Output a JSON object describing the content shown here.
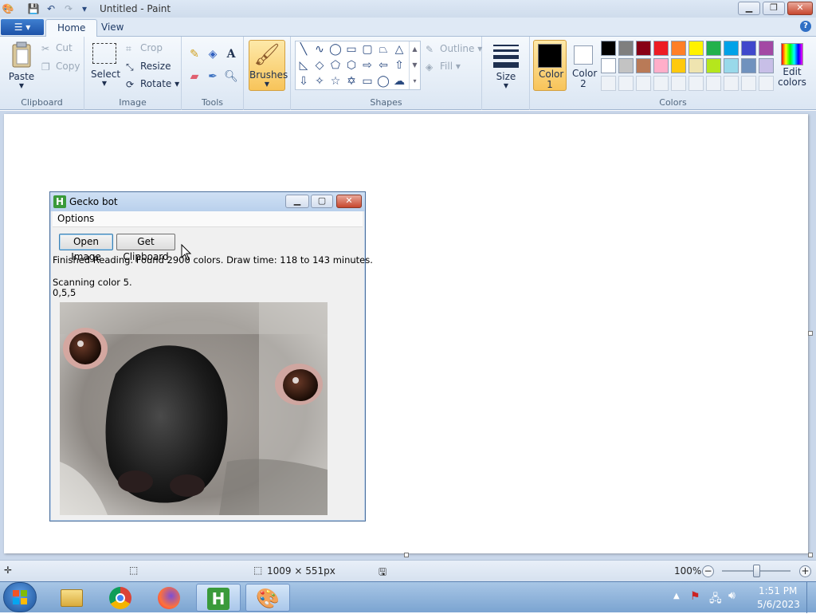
{
  "window": {
    "title": "Untitled - Paint"
  },
  "tabs": [
    {
      "label": "Home"
    },
    {
      "label": "View"
    }
  ],
  "clipboard": {
    "paste": "Paste",
    "cut": "Cut",
    "copy": "Copy",
    "label": "Clipboard"
  },
  "image": {
    "select": "Select",
    "crop": "Crop",
    "resize": "Resize",
    "rotate": "Rotate",
    "label": "Image"
  },
  "tools": {
    "label": "Tools"
  },
  "brushes": {
    "label": "Brushes"
  },
  "shapes": {
    "outline": "Outline",
    "fill": "Fill",
    "label": "Shapes"
  },
  "size": {
    "label": "Size"
  },
  "colors": {
    "color1": "Color 1",
    "color2": "Color 2",
    "edit": "Edit colors",
    "label": "Colors",
    "palette_row1": [
      "#000000",
      "#7f7f7f",
      "#880015",
      "#ed1c24",
      "#ff7f27",
      "#fff200",
      "#22b14c",
      "#00a2e8",
      "#3f48cc",
      "#a349a4"
    ],
    "palette_row2": [
      "#ffffff",
      "#c3c3c3",
      "#b97a57",
      "#ffaec9",
      "#ffc90e",
      "#efe4b0",
      "#b5e61d",
      "#99d9ea",
      "#7092be",
      "#c8bfe7"
    ]
  },
  "status": {
    "dimensions": "1009 × 551px",
    "zoom": "100%"
  },
  "taskbar": {
    "time": "1:51 PM",
    "date": "5/6/2023"
  },
  "dialog": {
    "title": "Gecko bot",
    "menu": "Options",
    "open_image": "Open Image",
    "get_clipboard": "Get Clipboard",
    "status_line": "Finished Reading. Found 2900 colors. Draw time: 118 to 143 minutes.",
    "scanning": "Scanning color 5.",
    "coords": "0,5,5"
  }
}
